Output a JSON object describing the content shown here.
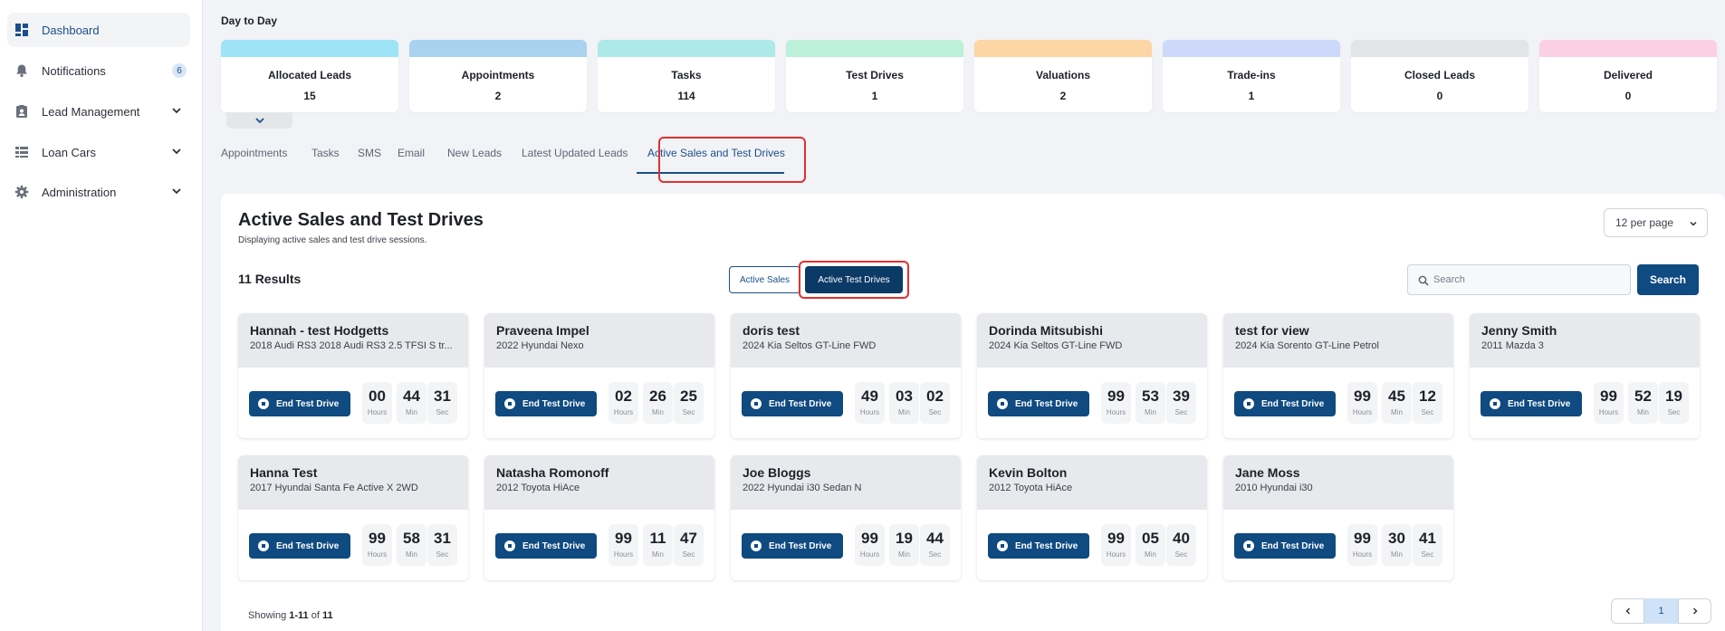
{
  "sidebar": {
    "items": [
      {
        "label": "Dashboard",
        "icon": "dashboard-icon",
        "active": true
      },
      {
        "label": "Notifications",
        "icon": "bell-icon",
        "badge": "6"
      },
      {
        "label": "Lead Management",
        "icon": "clipboard-icon",
        "expandable": true
      },
      {
        "label": "Loan Cars",
        "icon": "car-list-icon",
        "expandable": true
      },
      {
        "label": "Administration",
        "icon": "gear-icon",
        "expandable": true
      }
    ]
  },
  "day_to_day": {
    "title": "Day to Day",
    "stats": [
      {
        "label": "Allocated Leads",
        "value": "15",
        "color": "#9fe3f7"
      },
      {
        "label": "Appointments",
        "value": "2",
        "color": "#a9d2ee"
      },
      {
        "label": "Tasks",
        "value": "114",
        "color": "#aee9ea"
      },
      {
        "label": "Test Drives",
        "value": "1",
        "color": "#bdf0d8"
      },
      {
        "label": "Valuations",
        "value": "2",
        "color": "#fcd6a4"
      },
      {
        "label": "Trade-ins",
        "value": "1",
        "color": "#cdd9fb"
      },
      {
        "label": "Closed Leads",
        "value": "0",
        "color": "#e3e4e8"
      },
      {
        "label": "Delivered",
        "value": "0",
        "color": "#fbd0e6"
      }
    ]
  },
  "tabs": [
    {
      "label": "Appointments"
    },
    {
      "label": "Tasks"
    },
    {
      "label": "SMS"
    },
    {
      "label": "Email"
    },
    {
      "label": "New Leads"
    },
    {
      "label": "Latest Updated Leads"
    },
    {
      "label": "Active Sales and Test Drives",
      "active": true
    }
  ],
  "panel": {
    "title": "Active Sales and Test Drives",
    "subtitle": "Displaying active sales and test drive sessions.",
    "per_page": "12 per page",
    "results": "11 Results",
    "toggle_sales": "Active Sales",
    "toggle_drives": "Active Test Drives",
    "search_placeholder": "Search",
    "search_button": "Search",
    "end_label": "End Test Drive",
    "units": {
      "h": "Hours",
      "m": "Min",
      "s": "Sec"
    },
    "showing_prefix": "Showing ",
    "showing_range": "1-11",
    "showing_of": " of ",
    "showing_total": "11",
    "pagination": {
      "current": "1"
    }
  },
  "drives": [
    {
      "name": "Hannah - test Hodgetts",
      "car": "2018 Audi RS3 2018 Audi RS3 2.5 TFSI S tr...",
      "h": "00",
      "m": "44",
      "s": "31"
    },
    {
      "name": "Praveena Impel",
      "car": "2022 Hyundai Nexo",
      "h": "02",
      "m": "26",
      "s": "25"
    },
    {
      "name": "doris test",
      "car": "2024 Kia Seltos GT-Line FWD",
      "h": "49",
      "m": "03",
      "s": "02"
    },
    {
      "name": "Dorinda Mitsubishi",
      "car": "2024 Kia Seltos GT-Line FWD",
      "h": "99",
      "m": "53",
      "s": "39"
    },
    {
      "name": "test for view",
      "car": "2024 Kia Sorento GT-Line Petrol",
      "h": "99",
      "m": "45",
      "s": "12"
    },
    {
      "name": "Jenny Smith",
      "car": "2011 Mazda 3",
      "h": "99",
      "m": "52",
      "s": "19"
    },
    {
      "name": "Hanna Test",
      "car": "2017 Hyundai Santa Fe Active X 2WD",
      "h": "99",
      "m": "58",
      "s": "31"
    },
    {
      "name": "Natasha Romonoff",
      "car": "2012 Toyota HiAce",
      "h": "99",
      "m": "11",
      "s": "47"
    },
    {
      "name": "Joe Bloggs",
      "car": "2022 Hyundai i30 Sedan N",
      "h": "99",
      "m": "19",
      "s": "44"
    },
    {
      "name": "Kevin Bolton",
      "car": "2012 Toyota HiAce",
      "h": "99",
      "m": "05",
      "s": "40"
    },
    {
      "name": "Jane Moss",
      "car": "2010 Hyundai i30",
      "h": "99",
      "m": "30",
      "s": "41"
    }
  ]
}
